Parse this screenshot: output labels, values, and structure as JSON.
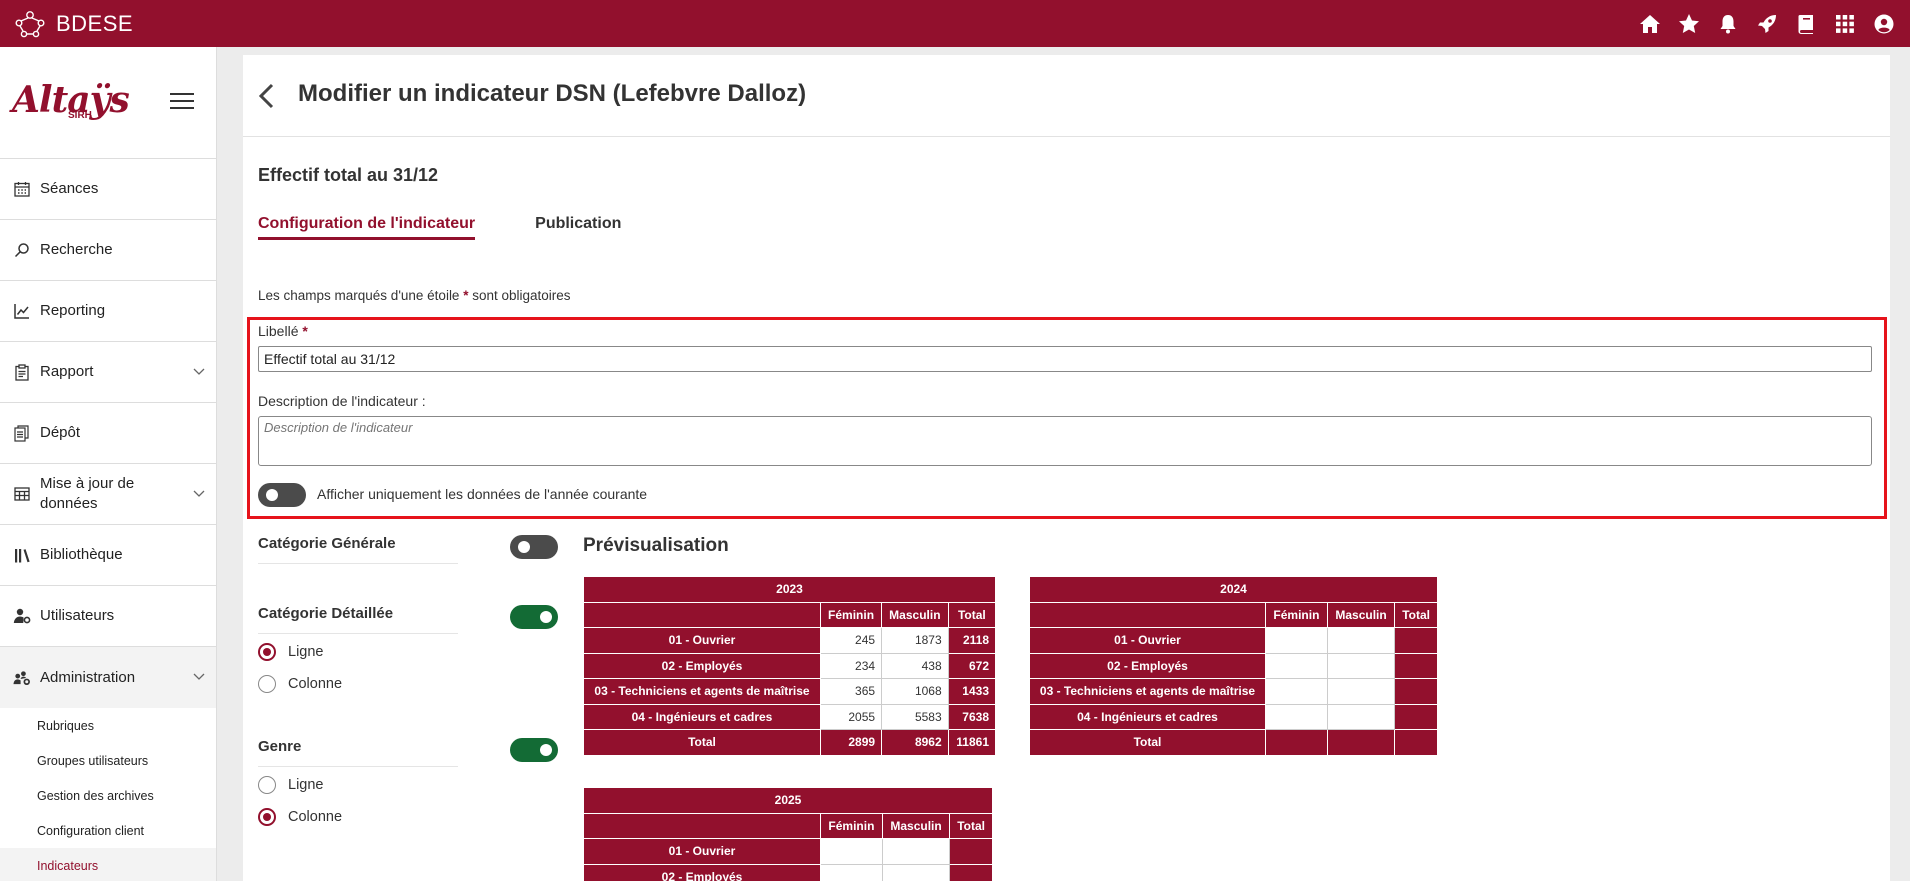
{
  "app": {
    "brand": "BDESE"
  },
  "sidebar": {
    "logo_text": "Altaÿs",
    "logo_sub": "SIRH",
    "items": [
      {
        "label": "Séances",
        "icon": "calendar-icon"
      },
      {
        "label": "Recherche",
        "icon": "search-icon"
      },
      {
        "label": "Reporting",
        "icon": "chart-line-icon"
      },
      {
        "label": "Rapport",
        "icon": "clipboard-icon",
        "expandable": true
      },
      {
        "label": "Dépôt",
        "icon": "documents-icon"
      },
      {
        "label": "Mise à jour de données",
        "icon": "table-icon",
        "expandable": true
      },
      {
        "label": "Bibliothèque",
        "icon": "books-icon"
      },
      {
        "label": "Utilisateurs",
        "icon": "user-gear-icon"
      },
      {
        "label": "Administration",
        "icon": "users-gear-icon",
        "expandable": true
      }
    ],
    "sub_items": [
      {
        "label": "Rubriques",
        "active": false
      },
      {
        "label": "Groupes utilisateurs",
        "active": false
      },
      {
        "label": "Gestion des archives",
        "active": false
      },
      {
        "label": "Configuration client",
        "active": false
      },
      {
        "label": "Indicateurs",
        "active": true
      }
    ]
  },
  "page": {
    "title": "Modifier un indicateur DSN (Lefebvre Dalloz)",
    "indicator_title": "Effectif total au 31/12",
    "tabs": [
      {
        "label": "Configuration de l'indicateur",
        "active": true
      },
      {
        "label": "Publication",
        "active": false
      }
    ],
    "mandatory_prefix": "Les champs marqués d'une étoile",
    "mandatory_star": "*",
    "mandatory_suffix": "sont obligatoires"
  },
  "form": {
    "libelle_label": "Libellé",
    "libelle_star": "*",
    "libelle_value": "Effectif total au 31/12",
    "description_label": "Description de l'indicateur :",
    "description_placeholder": "Description de l'indicateur",
    "current_year_toggle_label": "Afficher uniquement les données de l'année courante",
    "current_year_toggle_on": false
  },
  "categories": {
    "generale": {
      "label": "Catégorie Générale",
      "on": false
    },
    "detaillee": {
      "label": "Catégorie Détaillée",
      "on": true,
      "options": [
        "Ligne",
        "Colonne"
      ],
      "selected": "Ligne"
    },
    "genre": {
      "label": "Genre",
      "on": true,
      "options": [
        "Ligne",
        "Colonne"
      ],
      "selected": "Colonne"
    }
  },
  "preview": {
    "title": "Prévisualisation",
    "columns": [
      "Féminin",
      "Masculin",
      "Total"
    ],
    "rows": [
      "01 - Ouvrier",
      "02 - Employés",
      "03 - Techniciens et agents de maîtrise",
      "04 - Ingénieurs et cadres"
    ],
    "total_label": "Total",
    "tables": [
      {
        "year": "2023",
        "data": [
          [
            "245",
            "1873",
            "2118"
          ],
          [
            "234",
            "438",
            "672"
          ],
          [
            "365",
            "1068",
            "1433"
          ],
          [
            "2055",
            "5583",
            "7638"
          ]
        ],
        "totals": [
          "2899",
          "8962",
          "11861"
        ]
      },
      {
        "year": "2024",
        "data": [
          [
            "",
            "",
            ""
          ],
          [
            "",
            "",
            ""
          ],
          [
            "",
            "",
            ""
          ],
          [
            "",
            "",
            ""
          ]
        ],
        "totals": [
          "",
          "",
          ""
        ]
      },
      {
        "year": "2025",
        "data": [
          [
            "",
            "",
            ""
          ],
          [
            "",
            "",
            ""
          ]
        ],
        "totals": []
      }
    ]
  }
}
